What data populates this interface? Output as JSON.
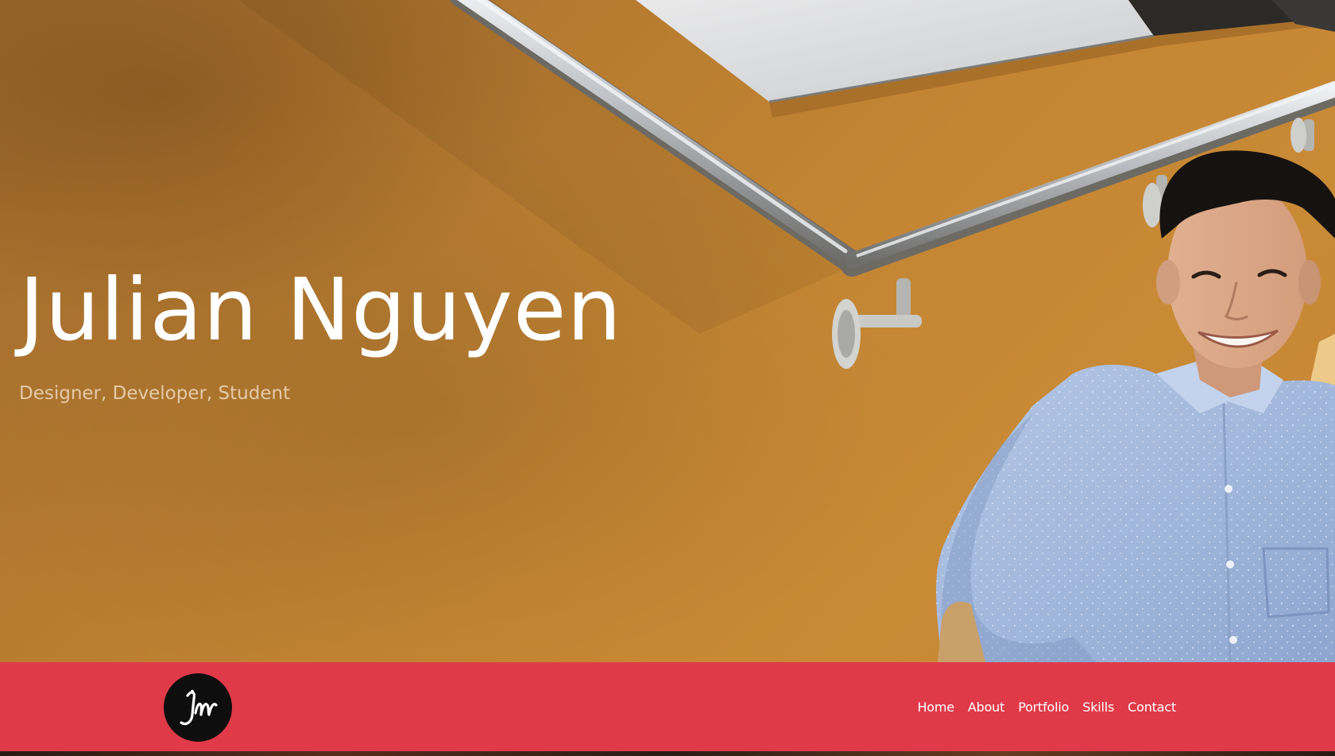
{
  "hero": {
    "name": "Julian Nguyen",
    "tagline": "Designer, Developer, Student",
    "image": "photo of a smiling young man in a light blue button-up shirt sitting beside an orange stairwell wall with metal handrails"
  },
  "nav": {
    "logo_icon": "jn-monogram-logo",
    "links": [
      "Home",
      "About",
      "Portfolio",
      "Skills",
      "Contact"
    ]
  },
  "colors": {
    "navbar_bg": "#e03a49",
    "hero_wall": "#c48633",
    "logo_bg": "#0e0e0e",
    "text": "#ffffff"
  }
}
